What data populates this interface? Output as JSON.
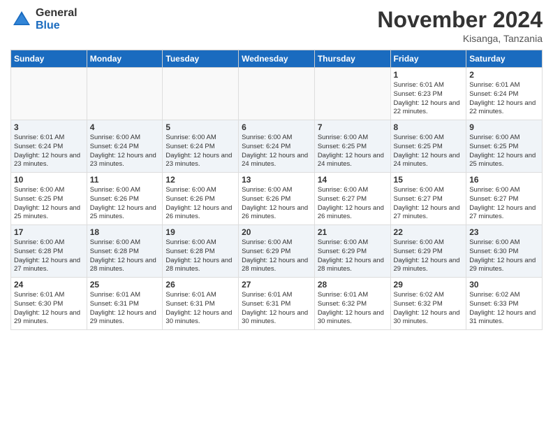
{
  "header": {
    "logo_general": "General",
    "logo_blue": "Blue",
    "month_title": "November 2024",
    "location": "Kisanga, Tanzania"
  },
  "weekdays": [
    "Sunday",
    "Monday",
    "Tuesday",
    "Wednesday",
    "Thursday",
    "Friday",
    "Saturday"
  ],
  "weeks": [
    [
      {
        "day": "",
        "info": ""
      },
      {
        "day": "",
        "info": ""
      },
      {
        "day": "",
        "info": ""
      },
      {
        "day": "",
        "info": ""
      },
      {
        "day": "",
        "info": ""
      },
      {
        "day": "1",
        "info": "Sunrise: 6:01 AM\nSunset: 6:23 PM\nDaylight: 12 hours and 22 minutes."
      },
      {
        "day": "2",
        "info": "Sunrise: 6:01 AM\nSunset: 6:24 PM\nDaylight: 12 hours and 22 minutes."
      }
    ],
    [
      {
        "day": "3",
        "info": "Sunrise: 6:01 AM\nSunset: 6:24 PM\nDaylight: 12 hours and 23 minutes."
      },
      {
        "day": "4",
        "info": "Sunrise: 6:00 AM\nSunset: 6:24 PM\nDaylight: 12 hours and 23 minutes."
      },
      {
        "day": "5",
        "info": "Sunrise: 6:00 AM\nSunset: 6:24 PM\nDaylight: 12 hours and 23 minutes."
      },
      {
        "day": "6",
        "info": "Sunrise: 6:00 AM\nSunset: 6:24 PM\nDaylight: 12 hours and 24 minutes."
      },
      {
        "day": "7",
        "info": "Sunrise: 6:00 AM\nSunset: 6:25 PM\nDaylight: 12 hours and 24 minutes."
      },
      {
        "day": "8",
        "info": "Sunrise: 6:00 AM\nSunset: 6:25 PM\nDaylight: 12 hours and 24 minutes."
      },
      {
        "day": "9",
        "info": "Sunrise: 6:00 AM\nSunset: 6:25 PM\nDaylight: 12 hours and 25 minutes."
      }
    ],
    [
      {
        "day": "10",
        "info": "Sunrise: 6:00 AM\nSunset: 6:25 PM\nDaylight: 12 hours and 25 minutes."
      },
      {
        "day": "11",
        "info": "Sunrise: 6:00 AM\nSunset: 6:26 PM\nDaylight: 12 hours and 25 minutes."
      },
      {
        "day": "12",
        "info": "Sunrise: 6:00 AM\nSunset: 6:26 PM\nDaylight: 12 hours and 26 minutes."
      },
      {
        "day": "13",
        "info": "Sunrise: 6:00 AM\nSunset: 6:26 PM\nDaylight: 12 hours and 26 minutes."
      },
      {
        "day": "14",
        "info": "Sunrise: 6:00 AM\nSunset: 6:27 PM\nDaylight: 12 hours and 26 minutes."
      },
      {
        "day": "15",
        "info": "Sunrise: 6:00 AM\nSunset: 6:27 PM\nDaylight: 12 hours and 27 minutes."
      },
      {
        "day": "16",
        "info": "Sunrise: 6:00 AM\nSunset: 6:27 PM\nDaylight: 12 hours and 27 minutes."
      }
    ],
    [
      {
        "day": "17",
        "info": "Sunrise: 6:00 AM\nSunset: 6:28 PM\nDaylight: 12 hours and 27 minutes."
      },
      {
        "day": "18",
        "info": "Sunrise: 6:00 AM\nSunset: 6:28 PM\nDaylight: 12 hours and 28 minutes."
      },
      {
        "day": "19",
        "info": "Sunrise: 6:00 AM\nSunset: 6:28 PM\nDaylight: 12 hours and 28 minutes."
      },
      {
        "day": "20",
        "info": "Sunrise: 6:00 AM\nSunset: 6:29 PM\nDaylight: 12 hours and 28 minutes."
      },
      {
        "day": "21",
        "info": "Sunrise: 6:00 AM\nSunset: 6:29 PM\nDaylight: 12 hours and 28 minutes."
      },
      {
        "day": "22",
        "info": "Sunrise: 6:00 AM\nSunset: 6:29 PM\nDaylight: 12 hours and 29 minutes."
      },
      {
        "day": "23",
        "info": "Sunrise: 6:00 AM\nSunset: 6:30 PM\nDaylight: 12 hours and 29 minutes."
      }
    ],
    [
      {
        "day": "24",
        "info": "Sunrise: 6:01 AM\nSunset: 6:30 PM\nDaylight: 12 hours and 29 minutes."
      },
      {
        "day": "25",
        "info": "Sunrise: 6:01 AM\nSunset: 6:31 PM\nDaylight: 12 hours and 29 minutes."
      },
      {
        "day": "26",
        "info": "Sunrise: 6:01 AM\nSunset: 6:31 PM\nDaylight: 12 hours and 30 minutes."
      },
      {
        "day": "27",
        "info": "Sunrise: 6:01 AM\nSunset: 6:31 PM\nDaylight: 12 hours and 30 minutes."
      },
      {
        "day": "28",
        "info": "Sunrise: 6:01 AM\nSunset: 6:32 PM\nDaylight: 12 hours and 30 minutes."
      },
      {
        "day": "29",
        "info": "Sunrise: 6:02 AM\nSunset: 6:32 PM\nDaylight: 12 hours and 30 minutes."
      },
      {
        "day": "30",
        "info": "Sunrise: 6:02 AM\nSunset: 6:33 PM\nDaylight: 12 hours and 31 minutes."
      }
    ]
  ]
}
